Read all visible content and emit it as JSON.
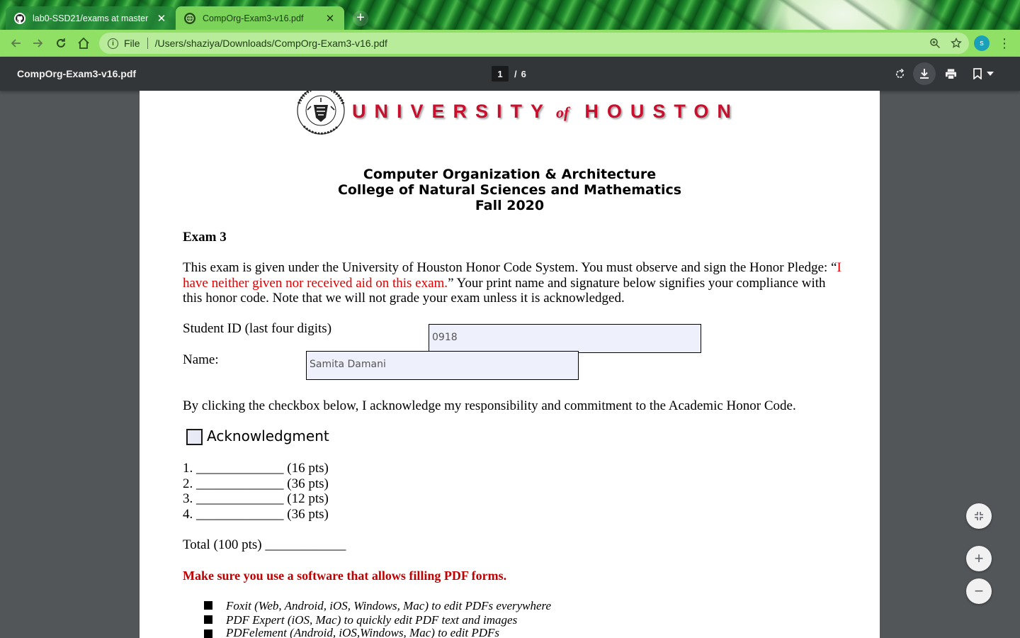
{
  "browser": {
    "tabs": [
      {
        "title": "lab0-SSD21/exams at master · ",
        "icon": "github-icon",
        "close": "✕"
      },
      {
        "title": "CompOrg-Exam3-v16.pdf",
        "icon": "globe-icon",
        "close": "✕"
      }
    ],
    "new_tab": "+",
    "address": {
      "scheme_label": "File",
      "url": "/Users/shaziya/Downloads/CompOrg-Exam3-v16.pdf"
    },
    "profile_initial": "s",
    "theme_accent": "#8fe064"
  },
  "pdf_viewer": {
    "filename": "CompOrg-Exam3-v16.pdf",
    "current_page": "1",
    "separator": "/",
    "total_pages": "6",
    "toolbar_colors": {
      "bar": "#323639",
      "background": "#525659"
    }
  },
  "document": {
    "logo": {
      "seal_ring_text": "UNIVERSITY OF HOUSTON",
      "seal_founded": "Founded 1927",
      "word_left": "UNIVERSITY",
      "word_of": "of",
      "word_right": "HOUSTON",
      "brand_color": "#c8102e"
    },
    "heading_lines": [
      "Computer Organization & Architecture",
      "College of Natural Sciences and Mathematics",
      "Fall 2020"
    ],
    "exam_title": "Exam 3",
    "honor_intro": "This exam is given under the University of Houston Honor Code System. You must observe and sign the Honor Pledge: “",
    "honor_red_line1": "I",
    "honor_red_line2": "have neither given nor received aid on this exam.",
    "honor_rest_line2": "” Your print name and signature below signifies your compliance with",
    "honor_line3": "this honor code. Note that we will not grade your exam unless it is acknowledged.",
    "student_id_label": "Student ID (last four digits)",
    "student_id_value": "0918",
    "name_label": "Name:",
    "name_value": "Samita Damani",
    "checkbox_statement": "By clicking the checkbox below, I acknowledge my responsibility and commitment to the Academic Honor Code.",
    "ack_label": "Acknowledgment",
    "ack_checked": false,
    "score_lines": [
      "1. _____________ (16 pts)",
      "2. _____________ (36 pts)",
      "3. _____________ (12 pts)",
      "4. _____________ (36 pts)"
    ],
    "total_line": "Total (100 pts) ____________",
    "software_note": "Make sure you use a software that allows filling PDF forms.",
    "software_list": [
      "Foxit (Web, Android, iOS, Windows, Mac) to edit PDFs everywhere",
      "PDF Expert (iOS, Mac) to quickly edit PDF text and images",
      "PDFelement (Android, iOS,Windows, Mac) to edit PDFs"
    ]
  },
  "zoom_controls": {
    "fit": "⤡",
    "zoom_in": "+",
    "zoom_out": "−"
  }
}
